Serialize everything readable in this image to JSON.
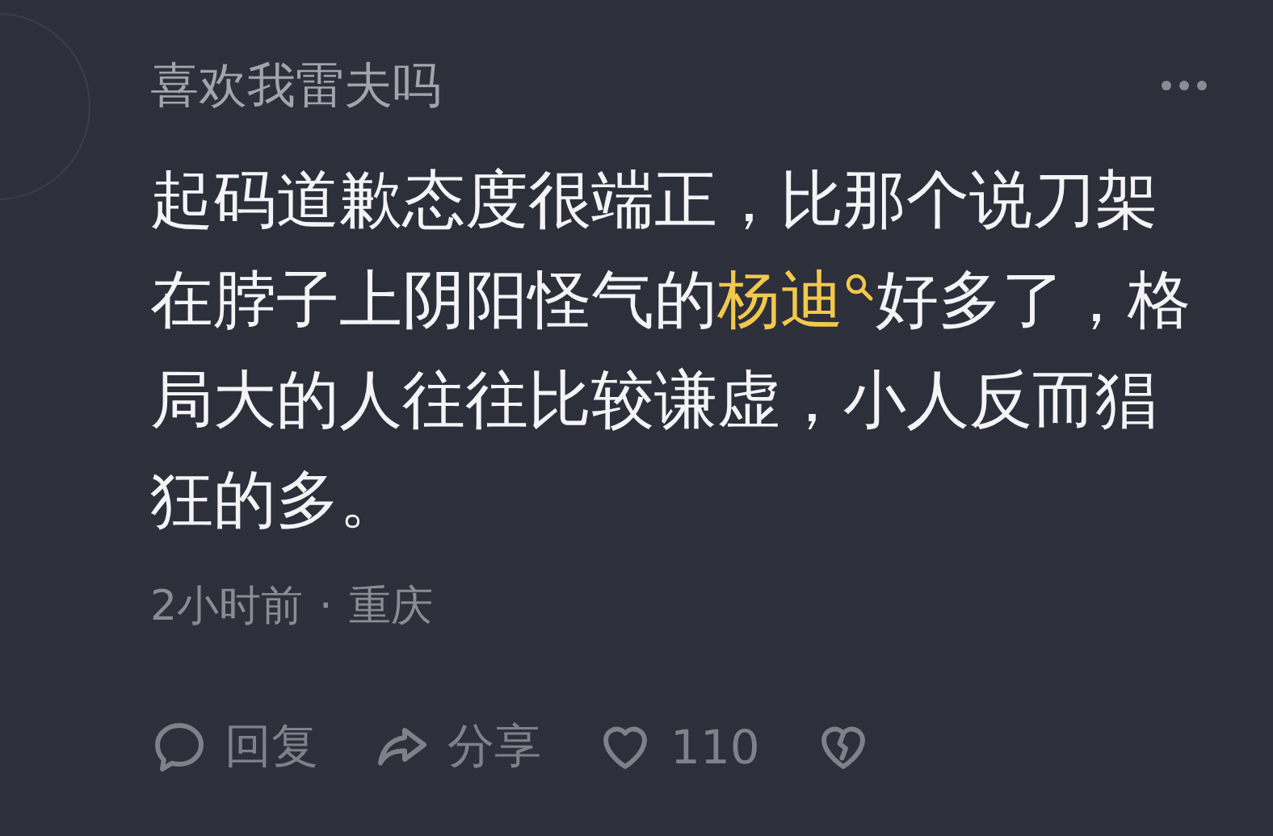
{
  "comment": {
    "username": "喜欢我雷夫吗",
    "segments": [
      {
        "kind": "plain",
        "text": "起码道歉态度很端正，比那个说刀架在脖子上阴阳怪气的"
      },
      {
        "kind": "search_link",
        "text": "杨迪"
      },
      {
        "kind": "plain",
        "text": "好多了，格局大的人往往比较谦虚，小人反而猖狂的多。"
      }
    ],
    "time": "2小时前",
    "separator": "·",
    "location": "重庆",
    "actions": [
      {
        "kind": "reply",
        "label": "回复"
      },
      {
        "kind": "share",
        "label": "分享"
      },
      {
        "kind": "like",
        "label": "110"
      },
      {
        "kind": "dislike"
      }
    ]
  }
}
